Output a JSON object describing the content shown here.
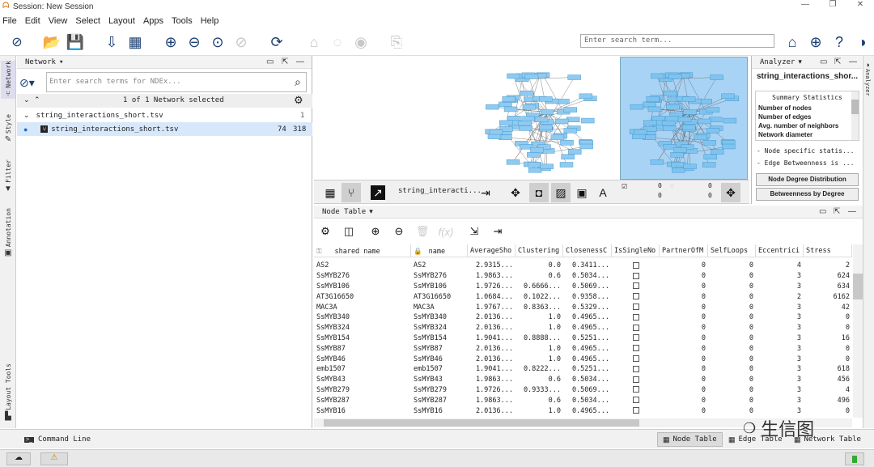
{
  "window": {
    "title": "Session: New Session"
  },
  "menu": [
    "File",
    "Edit",
    "View",
    "Select",
    "Layout",
    "Apps",
    "Tools",
    "Help"
  ],
  "toolbar": {
    "search_placeholder": "Enter search term..."
  },
  "left_tabs": [
    "Network",
    "Style",
    "Filter",
    "Annotation",
    "Layout Tools"
  ],
  "network_panel": {
    "title": "Network",
    "search_placeholder": "Enter search terms for NDEx...",
    "status": "1 of 1 Network selected",
    "collection": {
      "name": "string_interactions_short.tsv",
      "count": "1"
    },
    "network": {
      "name": "string_interactions_short.tsv",
      "nodes": "74",
      "edges": "318"
    }
  },
  "view_toolbar": {
    "network_name": "string_interacti...",
    "counts": [
      "0",
      "0",
      "0",
      "0"
    ]
  },
  "analyzer": {
    "title": "Analyzer",
    "network": "string_interactions_shor...",
    "summary_title": "Summary Statistics",
    "stats": [
      "Number of nodes",
      "Number of edges",
      "Avg. number of neighbors",
      "Network diameter"
    ],
    "items": [
      "- Node specific statis...",
      "- Edge Betweenness is ..."
    ],
    "buttons": [
      "Node Degree Distribution",
      "Betweenness by Degree"
    ]
  },
  "right_tab": "Analyzer",
  "node_table": {
    "title": "Node Table",
    "columns": [
      "shared name",
      "name",
      "AverageSho",
      "Clustering",
      "ClosenessC",
      "IsSingleNo",
      "PartnerOfM",
      "SelfLoops",
      "Eccentrici",
      "Stress"
    ],
    "rows": [
      [
        "AS2",
        "AS2",
        "2.9315...",
        "0.0",
        "0.3411...",
        "",
        "0",
        "0",
        "4",
        "2"
      ],
      [
        "SsMYB276",
        "SsMYB276",
        "1.9863...",
        "0.6",
        "0.5034...",
        "",
        "0",
        "0",
        "3",
        "624"
      ],
      [
        "SsMYB106",
        "SsMYB106",
        "1.9726...",
        "0.6666...",
        "0.5069...",
        "",
        "0",
        "0",
        "3",
        "634"
      ],
      [
        "AT3G16650",
        "AT3G16650",
        "1.0684...",
        "0.1022...",
        "0.9358...",
        "",
        "0",
        "0",
        "2",
        "6162"
      ],
      [
        "MAC3A",
        "MAC3A",
        "1.9767...",
        "0.8363...",
        "0.5329...",
        "",
        "0",
        "0",
        "3",
        "42"
      ],
      [
        "SsMYB340",
        "SsMYB340",
        "2.0136...",
        "1.0",
        "0.4965...",
        "",
        "0",
        "0",
        "3",
        "0"
      ],
      [
        "SsMYB324",
        "SsMYB324",
        "2.0136...",
        "1.0",
        "0.4965...",
        "",
        "0",
        "0",
        "3",
        "0"
      ],
      [
        "SsMYB154",
        "SsMYB154",
        "1.9041...",
        "0.8888...",
        "0.5251...",
        "",
        "0",
        "0",
        "3",
        "16"
      ],
      [
        "SsMYB87",
        "SsMYB87",
        "2.0136...",
        "1.0",
        "0.4965...",
        "",
        "0",
        "0",
        "3",
        "0"
      ],
      [
        "SsMYB46",
        "SsMYB46",
        "2.0136...",
        "1.0",
        "0.4965...",
        "",
        "0",
        "0",
        "3",
        "0"
      ],
      [
        "emb1507",
        "emb1507",
        "1.9041...",
        "0.8222...",
        "0.5251...",
        "",
        "0",
        "0",
        "3",
        "618"
      ],
      [
        "SsMYB43",
        "SsMYB43",
        "1.9863...",
        "0.6",
        "0.5034...",
        "",
        "0",
        "0",
        "3",
        "456"
      ],
      [
        "SsMYB279",
        "SsMYB279",
        "1.9726...",
        "0.9333...",
        "0.5069...",
        "",
        "0",
        "0",
        "3",
        "4"
      ],
      [
        "SsMYB287",
        "SsMYB287",
        "1.9863...",
        "0.6",
        "0.5034...",
        "",
        "0",
        "0",
        "3",
        "496"
      ],
      [
        "SsMYB16",
        "SsMYB16",
        "2.0136...",
        "1.0",
        "0.4965...",
        "",
        "0",
        "0",
        "3",
        "0"
      ]
    ]
  },
  "bottom": {
    "command_line": "Command Line",
    "tabs": [
      "Node Table",
      "Edge Table",
      "Network Table"
    ]
  },
  "watermark": "生信图"
}
